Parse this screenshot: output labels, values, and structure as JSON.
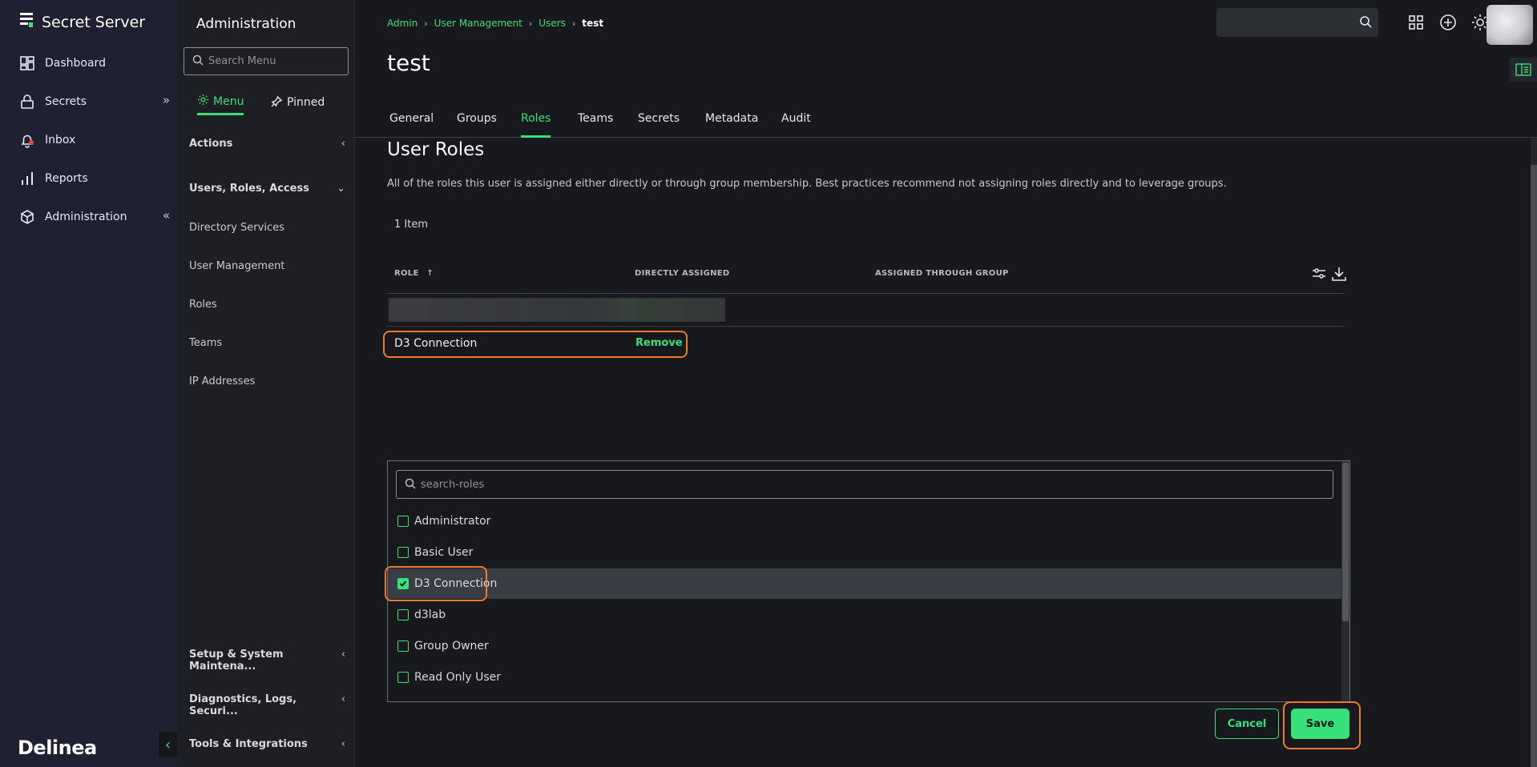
{
  "app": {
    "brand": "Secret Server",
    "footer_logo": "Delinea"
  },
  "nav": {
    "items": [
      {
        "label": "Dashboard",
        "icon": "dashboard-icon"
      },
      {
        "label": "Secrets",
        "icon": "lock-icon",
        "chevron": "»"
      },
      {
        "label": "Inbox",
        "icon": "bell-icon"
      },
      {
        "label": "Reports",
        "icon": "bar-chart-icon"
      },
      {
        "label": "Administration",
        "icon": "cube-icon",
        "chevron": "«"
      }
    ],
    "collapse": "‹"
  },
  "menu": {
    "title": "Administration",
    "search_placeholder": "Search Menu",
    "tab_menu": "Menu",
    "tab_pinned": "Pinned",
    "sections": {
      "actions": "Actions",
      "users": "Users, Roles, Access",
      "setup": "Setup & System Maintena...",
      "diag": "Diagnostics, Logs, Securi...",
      "tools": "Tools & Integrations"
    },
    "links": [
      "Directory Services",
      "User Management",
      "Roles",
      "Teams",
      "IP Addresses"
    ]
  },
  "header": {
    "breadcrumb": [
      "Admin",
      "User Management",
      "Users",
      "test"
    ],
    "title": "test"
  },
  "tabs": [
    "General",
    "Groups",
    "Roles",
    "Teams",
    "Secrets",
    "Metadata",
    "Audit"
  ],
  "roles": {
    "title": "User Roles",
    "description": "All of the roles this user is assigned either directly or through group membership. Best practices recommend not assigning roles directly and to leverage groups.",
    "count": "1 Item",
    "columns": {
      "role": "ROLE",
      "direct": "DIRECTLY ASSIGNED",
      "group": "ASSIGNED THROUGH GROUP"
    },
    "row": {
      "name": "D3 Connection",
      "action": "Remove"
    }
  },
  "picker": {
    "placeholder": "search-roles",
    "options": [
      {
        "label": "Administrator",
        "checked": false
      },
      {
        "label": "Basic User",
        "checked": false
      },
      {
        "label": "D3 Connection",
        "checked": true
      },
      {
        "label": "d3lab",
        "checked": false
      },
      {
        "label": "Group Owner",
        "checked": false
      },
      {
        "label": "Read Only User",
        "checked": false
      }
    ]
  },
  "buttons": {
    "cancel": "Cancel",
    "save": "Save"
  },
  "colors": {
    "accent": "#36e07b",
    "highlight": "#f07a2c",
    "nav_bg": "#1f2133"
  }
}
